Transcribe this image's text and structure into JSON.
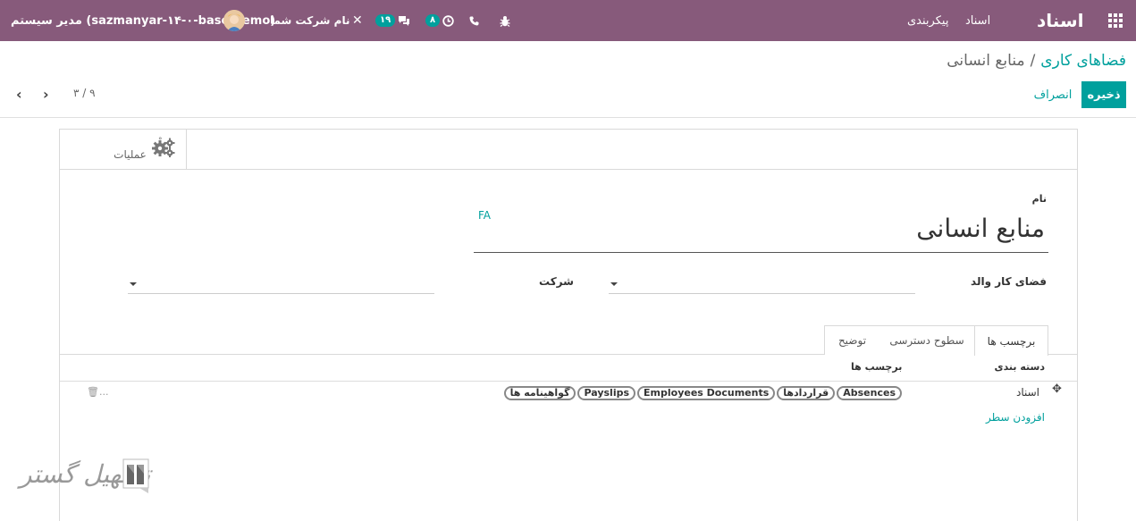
{
  "navbar": {
    "brand": "اسناد",
    "menu": [
      "اسناد",
      "پیکربندی"
    ],
    "user_name": "مدیر سیستم (sazmanyar-۱۴-۰-base-demo)",
    "company_name": "نام شرکت شما",
    "chat_count": "۱۹",
    "activity_count": "۸",
    "icons": [
      "apps-grid-icon",
      "avatar",
      "company-switch-icon",
      "chat-icon",
      "clock-icon",
      "phone-icon",
      "bug-icon"
    ],
    "bg_color": "#875a7b"
  },
  "breadcrumb": {
    "parent": "فضاهای کاری",
    "separator": "/",
    "current": "منابع انسانی"
  },
  "buttons": {
    "save": "ذخیره",
    "discard": "انصراف"
  },
  "pager": {
    "value": "۳ / ۹",
    "prev": "‹",
    "next": "›"
  },
  "sheet": {
    "action_label": "عملیات",
    "action_degree": "°",
    "name_label": "نام",
    "name_value": "منابع انسانی",
    "lang": "FA",
    "parent_label": "فضای کار والد",
    "company_label": "شرکت"
  },
  "tabs": [
    "برچسب ها",
    "سطوح دسترسی",
    "توضیح"
  ],
  "table": {
    "headers": [
      "دسته بندی",
      "برچسب ها"
    ],
    "rows": [
      {
        "category": "اسناد",
        "tags": [
          "Absences",
          "قراردادها",
          "Employees Documents",
          "Payslips",
          "گواهینامه ها"
        ],
        "trash": "🗑..."
      }
    ],
    "add_line": "افزودن سطر"
  },
  "watermark": {
    "text": "تسهیل گستر"
  },
  "colors": {
    "primary": "#00a09d",
    "nav": "#875a7b"
  }
}
